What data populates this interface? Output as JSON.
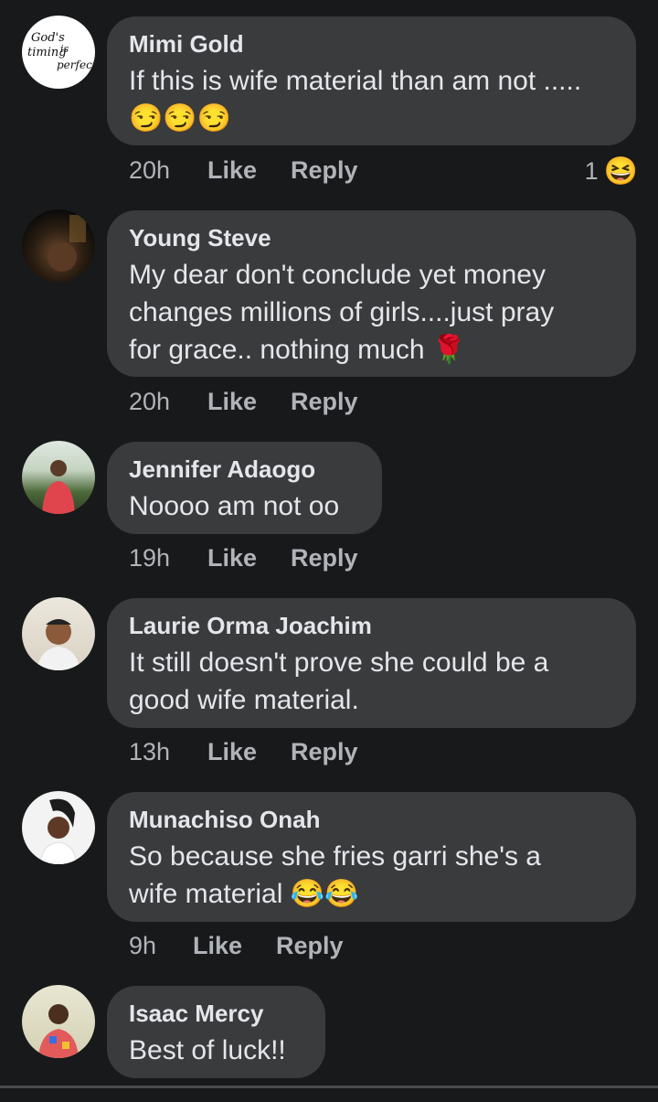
{
  "comments": [
    {
      "author": "Mimi Gold",
      "text": "If this is wife material than am not .....",
      "emojis": "😏😏😏",
      "time": "20h",
      "like": "Like",
      "reply": "Reply",
      "reaction_count": "1",
      "reaction_icon": "😆",
      "avatar_text": "God's timing is perfect"
    },
    {
      "author": "Young Steve",
      "text_line1": "My dear don't conclude yet money",
      "text_line2": "changes millions of girls....just pray",
      "text_line3": "for grace.. nothing much 🌹",
      "time": "20h",
      "like": "Like",
      "reply": "Reply"
    },
    {
      "author": "Jennifer Adaogo",
      "text": "Noooo am not oo",
      "time": "19h",
      "like": "Like",
      "reply": "Reply"
    },
    {
      "author": "Laurie Orma Joachim",
      "text_line1": "It still doesn't prove she could be a",
      "text_line2": "good wife material.",
      "time": "13h",
      "like": "Like",
      "reply": "Reply"
    },
    {
      "author": "Munachiso Onah",
      "text_line1": "So because she fries garri she's a",
      "text_line2": "wife material 😂😂",
      "time": "9h",
      "like": "Like",
      "reply": "Reply"
    },
    {
      "author": "Isaac Mercy",
      "text": "Best of luck!!"
    }
  ],
  "colors": {
    "background": "#18191a",
    "bubble": "#3a3b3c",
    "text": "#e4e6eb",
    "meta": "#b0b3b8"
  }
}
